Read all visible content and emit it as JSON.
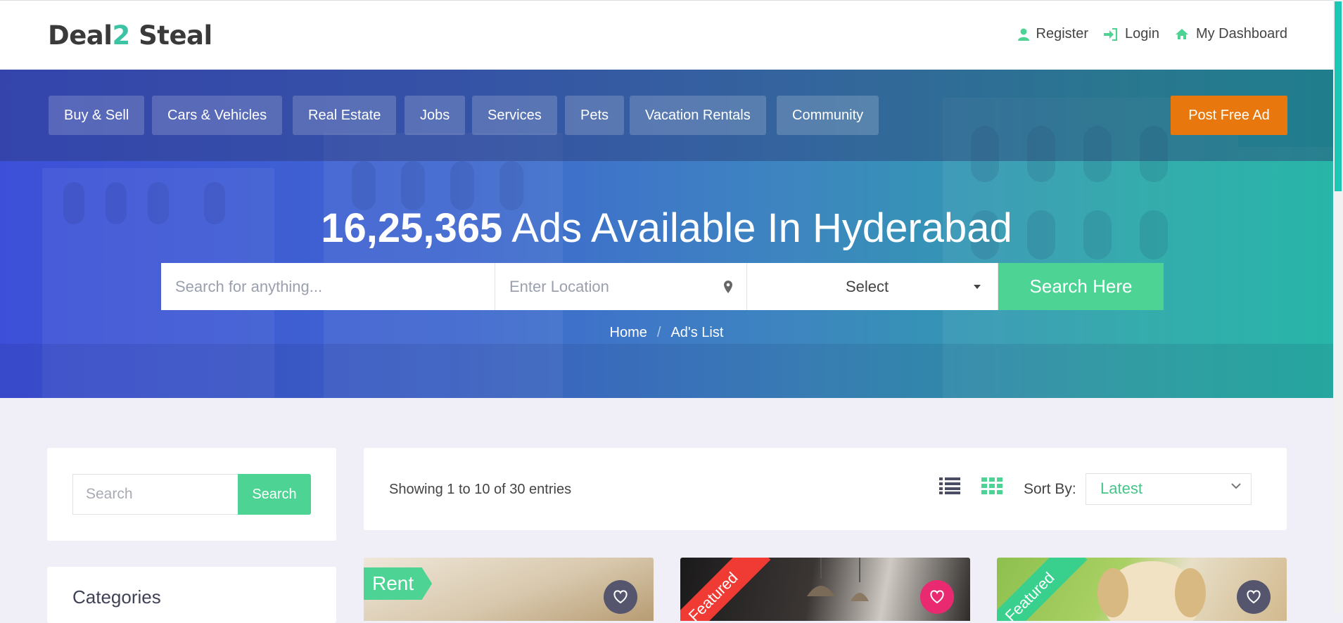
{
  "brand": {
    "part1": "Deal",
    "part2": "2",
    "part3": "Steal"
  },
  "top_links": [
    {
      "label": "Register",
      "icon": "user-icon"
    },
    {
      "label": "Login",
      "icon": "sign-in-icon"
    },
    {
      "label": "My Dashboard",
      "icon": "home-icon"
    }
  ],
  "categories": [
    "Buy & Sell",
    "Cars & Vehicles",
    "Real Estate",
    "Jobs",
    "Services",
    "Pets",
    "Vacation Rentals",
    "Community"
  ],
  "post_ad_label": "Post Free Ad",
  "hero": {
    "count": "16,25,365",
    "headline_rest": "Ads Available In Hyderabad"
  },
  "search": {
    "query_placeholder": "Search for anything...",
    "location_placeholder": "Enter Location",
    "select_value": "Select",
    "button_label": "Search Here"
  },
  "breadcrumb": {
    "home": "Home",
    "current": "Ad's List"
  },
  "sidebar": {
    "search_placeholder": "Search",
    "search_button": "Search",
    "categories_title": "Categories"
  },
  "results": {
    "showing_text": "Showing 1 to 10 of 30 entries",
    "sort_label": "Sort By:",
    "sort_value": "Latest"
  },
  "listings": [
    {
      "tag": "Rent"
    },
    {
      "ribbon": "Featured"
    },
    {
      "ribbon": "Featured"
    }
  ],
  "colors": {
    "accent_green": "#4dd394",
    "post_ad_orange": "#e8780d",
    "featured_red": "#ef3b34",
    "favorite_pink": "#e92a71"
  }
}
